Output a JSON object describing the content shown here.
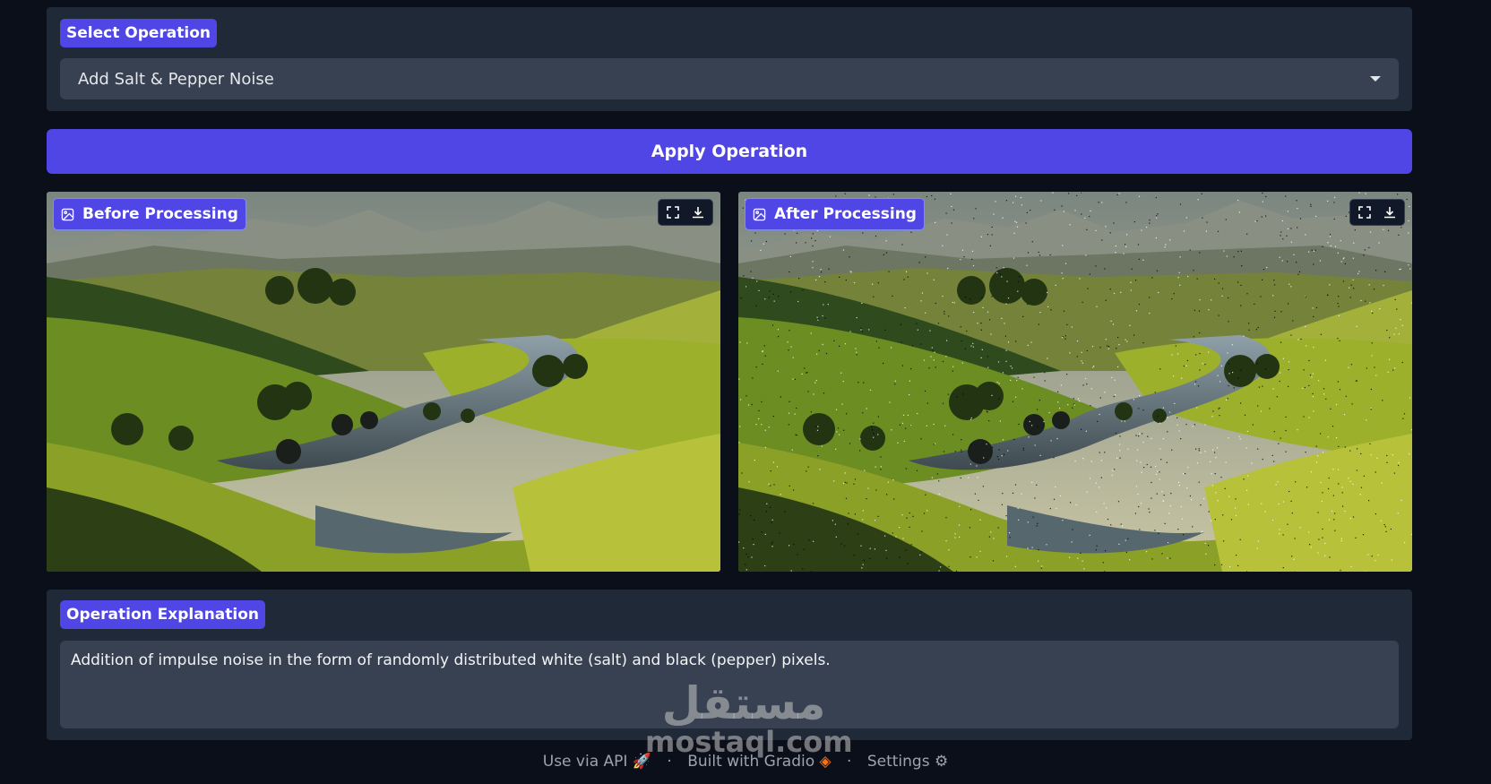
{
  "operation": {
    "label": "Select Operation",
    "selected": "Add Salt & Pepper Noise"
  },
  "apply_button": "Apply Operation",
  "before": {
    "label": "Before Processing"
  },
  "after": {
    "label": "After Processing"
  },
  "explanation": {
    "label": "Operation Explanation",
    "text": "Addition of impulse noise in the form of randomly distributed white (salt) and black (pepper) pixels."
  },
  "footer": {
    "api": "Use via API",
    "built": "Built with Gradio",
    "settings": "Settings"
  },
  "watermark": {
    "arabic": "مستقل",
    "latin": "mostaql.com"
  },
  "colors": {
    "accent": "#4f46e5",
    "panel": "#1f2937",
    "background": "#0b0f19"
  }
}
